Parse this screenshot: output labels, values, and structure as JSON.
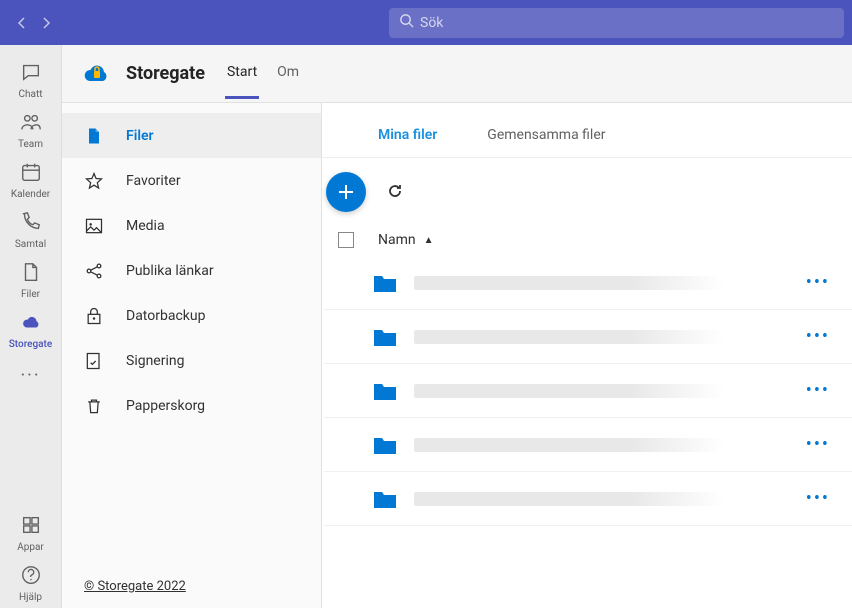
{
  "search": {
    "placeholder": "Sök"
  },
  "rail": {
    "items": [
      {
        "label": "Chatt",
        "icon": "chat"
      },
      {
        "label": "Team",
        "icon": "team"
      },
      {
        "label": "Kalender",
        "icon": "calendar"
      },
      {
        "label": "Samtal",
        "icon": "call"
      },
      {
        "label": "Filer",
        "icon": "file"
      },
      {
        "label": "Storegate",
        "icon": "cloud",
        "active": true
      }
    ],
    "bottom": [
      {
        "label": "Appar",
        "icon": "apps"
      },
      {
        "label": "Hjälp",
        "icon": "help"
      }
    ]
  },
  "app": {
    "name": "Storegate",
    "tabs": [
      {
        "label": "Start",
        "active": true
      },
      {
        "label": "Om"
      }
    ]
  },
  "sidebar": {
    "items": [
      {
        "label": "Filer",
        "icon": "file-solid",
        "active": true
      },
      {
        "label": "Favoriter",
        "icon": "star"
      },
      {
        "label": "Media",
        "icon": "image"
      },
      {
        "label": "Publika länkar",
        "icon": "share"
      },
      {
        "label": "Datorbackup",
        "icon": "lock"
      },
      {
        "label": "Signering",
        "icon": "sign"
      },
      {
        "label": "Papperskorg",
        "icon": "trash"
      }
    ],
    "copyright": "© Storegate 2022"
  },
  "files": {
    "tabs": [
      {
        "label": "Mina filer",
        "active": true
      },
      {
        "label": "Gemensamma filer"
      }
    ],
    "columns": {
      "name": "Namn"
    },
    "rows": [
      {},
      {},
      {},
      {},
      {}
    ]
  }
}
